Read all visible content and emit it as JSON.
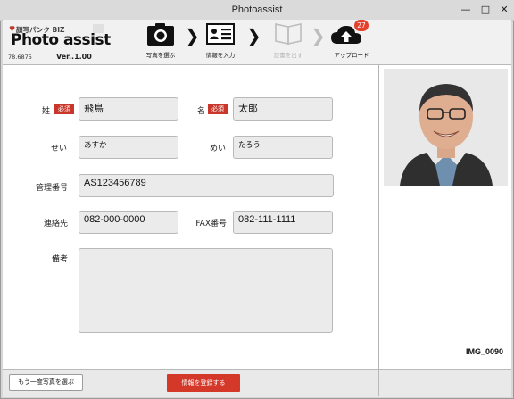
{
  "window": {
    "title": "Photoassist",
    "minimize": "—",
    "maximize": "□",
    "close": "✕"
  },
  "brand": {
    "sub": "顔写パンク BIZ",
    "name": "Photo assist",
    "build": "78.6875",
    "version": "Ver..1.00"
  },
  "steps": [
    {
      "label": "写真を選ぶ",
      "icon": "camera-icon",
      "enabled": true
    },
    {
      "label": "情報を入力",
      "icon": "id-card-icon",
      "enabled": true
    },
    {
      "label": "証書を出す",
      "icon": "book-icon",
      "enabled": false
    },
    {
      "label": "アップロード",
      "icon": "cloud-upload-icon",
      "enabled": true
    }
  ],
  "upload_badge": "27",
  "form": {
    "required_tag": "必須",
    "sei_label": "姓",
    "sei_value": "飛鳥",
    "mei_label": "名",
    "mei_value": "太郎",
    "sei_kana_label": "せい",
    "sei_kana_value": "あすか",
    "mei_kana_label": "めい",
    "mei_kana_value": "たろう",
    "mgmt_label": "管理番号",
    "mgmt_value": "AS123456789",
    "tel_label": "連絡先",
    "tel_value": "082-000-0000",
    "fax_label": "FAX番号",
    "fax_value": "082-111-1111",
    "note_label": "備考",
    "note_value": ""
  },
  "image_name": "IMG_0090",
  "buttons": {
    "back": "もう一度写真を選ぶ",
    "register": "情報を登録する"
  },
  "colors": {
    "accent_red": "#d43829",
    "badge_red": "#e3412d"
  }
}
